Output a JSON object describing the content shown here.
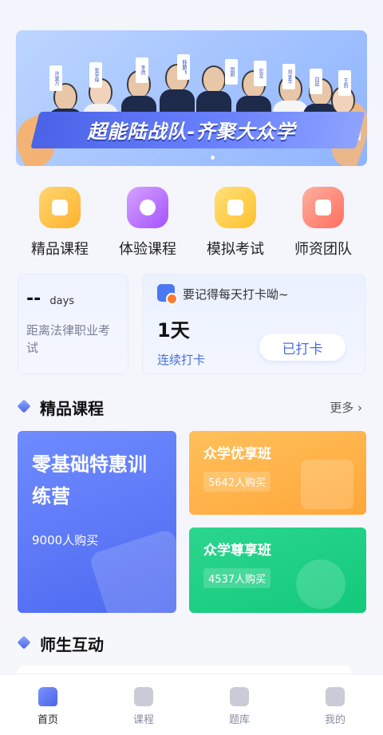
{
  "banner": {
    "title": "超能陆战队-齐聚大众学",
    "teachers": [
      "许景万",
      "张宇琛",
      "李然",
      "韩鹏飞",
      "田甜",
      "宏龙",
      "刘金华",
      "白廷",
      "王凯"
    ],
    "page_count": 1
  },
  "quick_nav": [
    {
      "label": "精品课程",
      "icon": "course-icon"
    },
    {
      "label": "体验课程",
      "icon": "play-icon"
    },
    {
      "label": "模拟考试",
      "icon": "exam-icon"
    },
    {
      "label": "师资团队",
      "icon": "teacher-icon"
    }
  ],
  "countdown": {
    "value": "--",
    "unit": "days",
    "desc": "距离法律职业考试"
  },
  "checkin": {
    "tip": "要记得每天打卡呦~",
    "days": "1天",
    "label": "连续打卡",
    "button": "已打卡"
  },
  "featured": {
    "title": "精品课程",
    "more": "更多",
    "courses": [
      {
        "title": "零基础特惠训练营",
        "buyers": "9000人购买",
        "color": "#5a76f5"
      },
      {
        "title": "众学优享班",
        "buyers": "5642人购买",
        "color": "#ffb04a"
      },
      {
        "title": "众学尊享班",
        "buyers": "4537人购买",
        "color": "#1fd085"
      }
    ]
  },
  "interaction": {
    "title": "师生互动"
  },
  "tabbar": [
    {
      "label": "首页",
      "icon": "home-icon",
      "active": true
    },
    {
      "label": "课程",
      "icon": "book-icon",
      "active": false
    },
    {
      "label": "题库",
      "icon": "library-icon",
      "active": false
    },
    {
      "label": "我的",
      "icon": "user-icon",
      "active": false
    }
  ]
}
